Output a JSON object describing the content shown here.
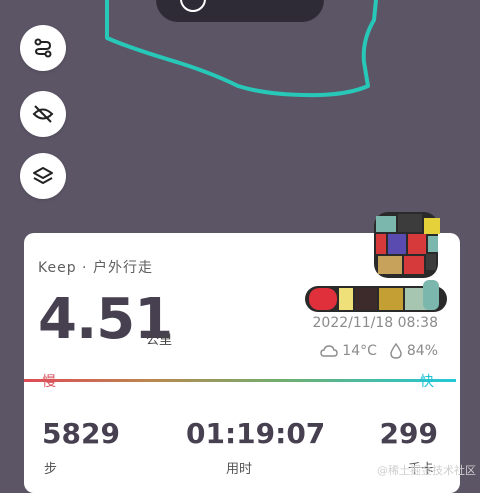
{
  "map": {
    "route_color": "#28c8b8",
    "background_color": "#5c5566"
  },
  "controls": [
    {
      "name": "route-icon"
    },
    {
      "name": "hide-icon"
    },
    {
      "name": "layers-icon"
    }
  ],
  "card": {
    "brand": "Keep · 户外行走",
    "distance": "4.51",
    "distance_unit": "公里",
    "datetime": "2022/11/18  08:38",
    "temperature": "14°C",
    "humidity": "84%",
    "speed_slow_label": "慢",
    "speed_fast_label": "快",
    "stats": [
      {
        "value": "5829",
        "label": "步"
      },
      {
        "value": "01:19:07",
        "label": "用时"
      },
      {
        "value": "299",
        "label": "千卡"
      }
    ]
  },
  "watermark": "@稀土掘金技术社区"
}
